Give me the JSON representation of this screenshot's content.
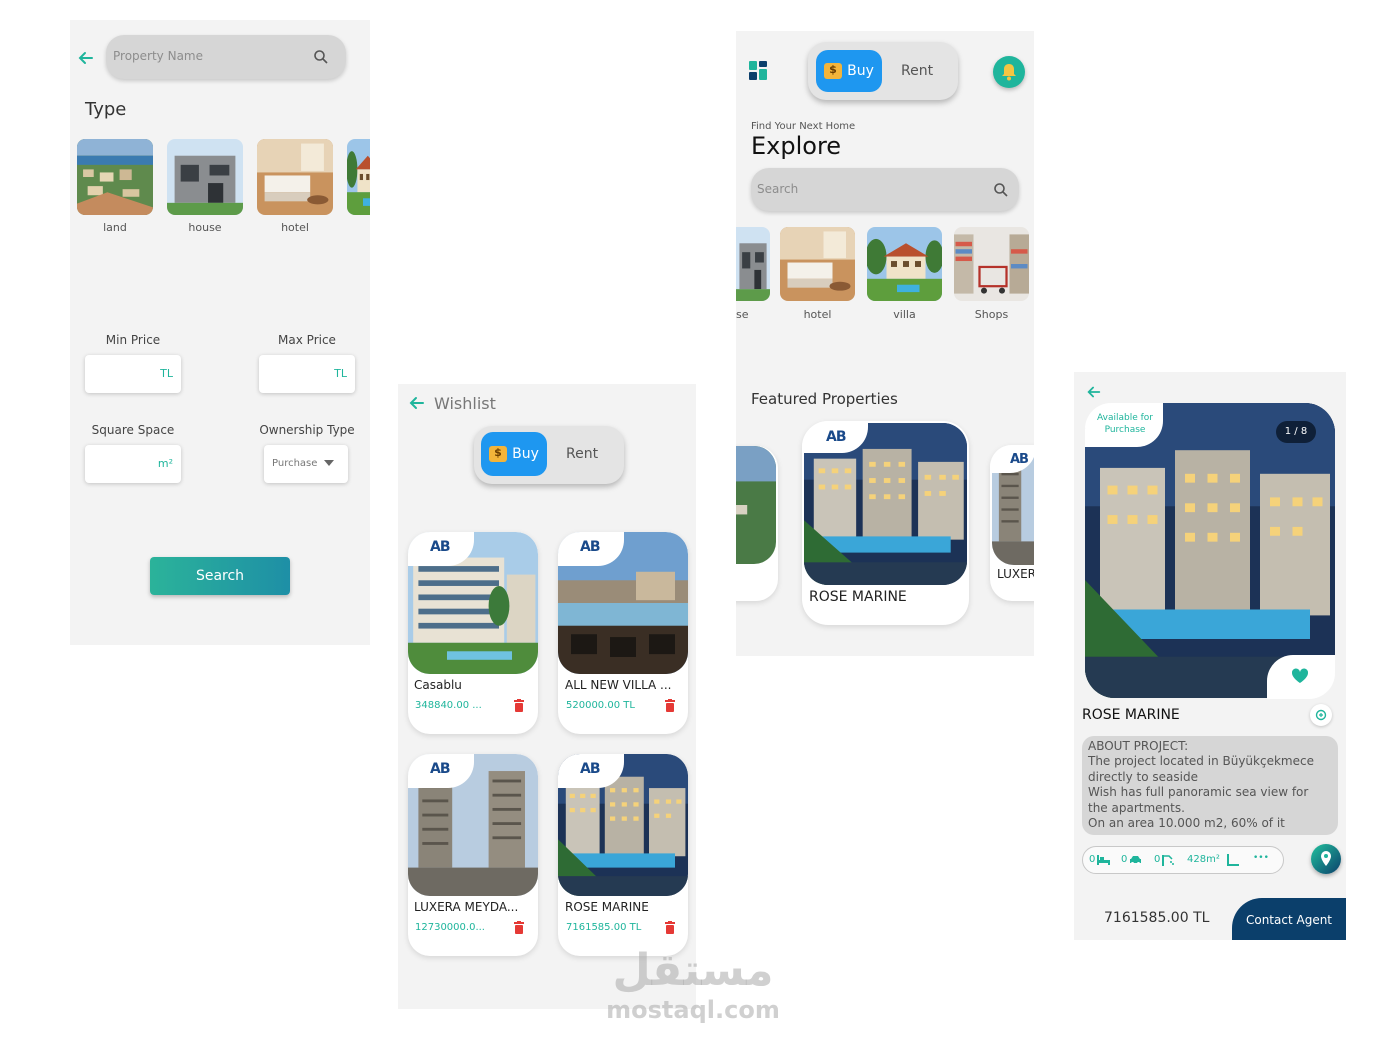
{
  "screen1": {
    "search_placeholder": "Property Name",
    "type_heading": "Type",
    "categories": [
      {
        "label": "land"
      },
      {
        "label": "house"
      },
      {
        "label": "hotel"
      }
    ],
    "min_price": {
      "label": "Min Price",
      "unit": "TL"
    },
    "max_price": {
      "label": "Max Price",
      "unit": "TL"
    },
    "square_space": {
      "label": "Square Space",
      "unit": "m²"
    },
    "ownership": {
      "label": "Ownership Type",
      "value": "Purchase"
    },
    "search_button": "Search"
  },
  "screen2": {
    "title": "Wishlist",
    "buy_label": "Buy",
    "rent_label": "Rent",
    "logo": "AB",
    "items": [
      {
        "name": "Casablu",
        "price": "348840.00 ..."
      },
      {
        "name": "ALL NEW VILLA ...",
        "price": "520000.00 TL"
      },
      {
        "name": "LUXERA MEYDA...",
        "price": "12730000.0..."
      },
      {
        "name": "ROSE MARINE",
        "price": "7161585.00 TL"
      }
    ]
  },
  "screen3": {
    "buy_label": "Buy",
    "rent_label": "Rent",
    "subtitle": "Find Your Next Home",
    "title": "Explore",
    "search_placeholder": "Search",
    "categories": [
      {
        "label": "se"
      },
      {
        "label": "hotel"
      },
      {
        "label": "villa"
      },
      {
        "label": "Shops"
      }
    ],
    "featured_heading": "Featured Properties",
    "featured": [
      {
        "name": "ROSE MARINE"
      },
      {
        "name": "LUXER"
      }
    ],
    "logo": "AB"
  },
  "screen4": {
    "availability": "Available for Purchase",
    "image_counter": "1 / 8",
    "name": "ROSE MARINE",
    "about_lines": [
      "ABOUT PROJECT:",
      "The project located in Büyükçekmece",
      "directly to seaside",
      "Wish has full panoramic sea view for",
      "the apartments.",
      "On an area 10.000 m2, 60% of it"
    ],
    "features": {
      "beds": "0",
      "cars": "0",
      "baths": "0",
      "area": "428m²",
      "more": "•••"
    },
    "price": "7161585.00 TL",
    "contact_button": "Contact Agent"
  },
  "watermark": {
    "arabic": "مستقل",
    "latin": "mostaql.com"
  },
  "colors": {
    "accent": "#1fb59c",
    "buy_blue": "#1e97f0",
    "delete_red": "#e53935",
    "navy": "#0b3f6b"
  }
}
